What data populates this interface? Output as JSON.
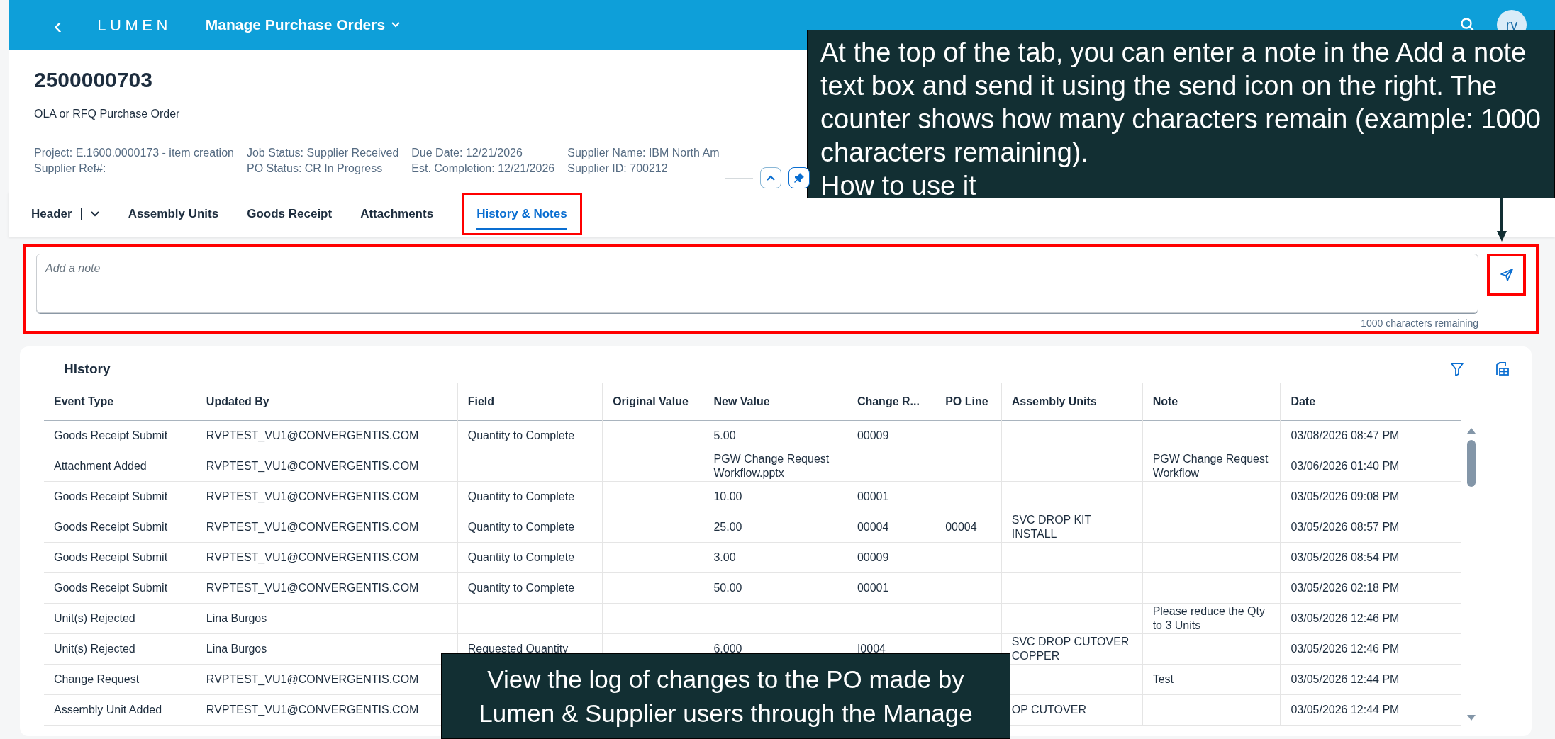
{
  "shell_bar": {
    "back": "‹",
    "logo": "LUMEN",
    "app_title": "Manage Purchase Orders",
    "avatar": "rv"
  },
  "object_header": {
    "title": "2500000703",
    "subtitle": "OLA or RFQ Purchase Order",
    "attributes": [
      [
        "Project: E.1600.0000173 - item creation",
        "Supplier Ref#:"
      ],
      [
        "Job Status: Supplier Received",
        "PO Status: CR In Progress"
      ],
      [
        "Due Date: 12/21/2026",
        "Est. Completion: 12/21/2026"
      ],
      [
        "Supplier Name: IBM North Am",
        "Supplier ID: 700212"
      ]
    ]
  },
  "tabs": [
    {
      "label": "Header",
      "selected": false,
      "menu": true
    },
    {
      "label": "Assembly Units",
      "selected": false
    },
    {
      "label": "Goods Receipt",
      "selected": false
    },
    {
      "label": "Attachments",
      "selected": false
    },
    {
      "label": "History & Notes",
      "selected": true,
      "highlighted": true
    }
  ],
  "note": {
    "placeholder": "Add a note",
    "counter": "1000 characters remaining",
    "highlighted": true
  },
  "history": {
    "title": "History",
    "columns": [
      "Event Type",
      "Updated By",
      "Field",
      "Original Value",
      "New Value",
      "Change R...",
      "PO Line",
      "Assembly Units",
      "Note",
      "Date"
    ],
    "rows": [
      {
        "event_type": "Goods Receipt Submit",
        "updated_by": "RVPTEST_VU1@CONVERGENTIS.COM",
        "field": "Quantity to Complete",
        "new_value": "5.00",
        "change_request": "00009",
        "date": "03/08/2026 08:47 PM"
      },
      {
        "event_type": "Attachment Added",
        "updated_by": "RVPTEST_VU1@CONVERGENTIS.COM",
        "new_value": "PGW Change Request Workflow.pptx",
        "note": "PGW Change Request Workflow",
        "date": "03/06/2026 01:40 PM"
      },
      {
        "event_type": "Goods Receipt Submit",
        "updated_by": "RVPTEST_VU1@CONVERGENTIS.COM",
        "field": "Quantity to Complete",
        "new_value": "10.00",
        "change_request": "00001",
        "date": "03/05/2026 09:08 PM"
      },
      {
        "event_type": "Goods Receipt Submit",
        "updated_by": "RVPTEST_VU1@CONVERGENTIS.COM",
        "field": "Quantity to Complete",
        "new_value": "25.00",
        "change_request": "00004",
        "po_line": "00004",
        "assembly_units": "SVC DROP KIT INSTALL",
        "date": "03/05/2026 08:57 PM"
      },
      {
        "event_type": "Goods Receipt Submit",
        "updated_by": "RVPTEST_VU1@CONVERGENTIS.COM",
        "field": "Quantity to Complete",
        "new_value": "3.00",
        "change_request": "00009",
        "date": "03/05/2026 08:54 PM"
      },
      {
        "event_type": "Goods Receipt Submit",
        "updated_by": "RVPTEST_VU1@CONVERGENTIS.COM",
        "field": "Quantity to Complete",
        "new_value": "50.00",
        "change_request": "00001",
        "date": "03/05/2026 02:18 PM"
      },
      {
        "event_type": "Unit(s) Rejected",
        "updated_by": "Lina Burgos",
        "note": "Please reduce the Qty to 3 Units",
        "date": "03/05/2026 12:46 PM"
      },
      {
        "event_type": "Unit(s) Rejected",
        "updated_by": "Lina Burgos",
        "field": "Requested Quantity",
        "new_value": "6.000",
        "change_request": "I0004",
        "assembly_units": "SVC DROP CUTOVER COPPER",
        "date": "03/05/2026 12:46 PM"
      },
      {
        "event_type": "Change Request",
        "updated_by": "RVPTEST_VU1@CONVERGENTIS.COM",
        "note": "Test",
        "date": "03/05/2026 12:44 PM"
      },
      {
        "event_type": "Assembly Unit Added",
        "updated_by": "RVPTEST_VU1@CONVERGENTIS.COM",
        "assembly_units": "OP CUTOVER",
        "date": "03/05/2026 12:44 PM"
      }
    ]
  },
  "callouts": [
    {
      "kind": "top",
      "text": "At the top of the tab, you can enter a note in the Add a note text box and send it using the send icon on the right. The counter shows how many characters remain (example: 1000 characters remaining).\nHow to use it"
    },
    {
      "kind": "bottom",
      "text": "View the log of changes to the PO made by Lumen & Supplier users through the Manage"
    }
  ]
}
